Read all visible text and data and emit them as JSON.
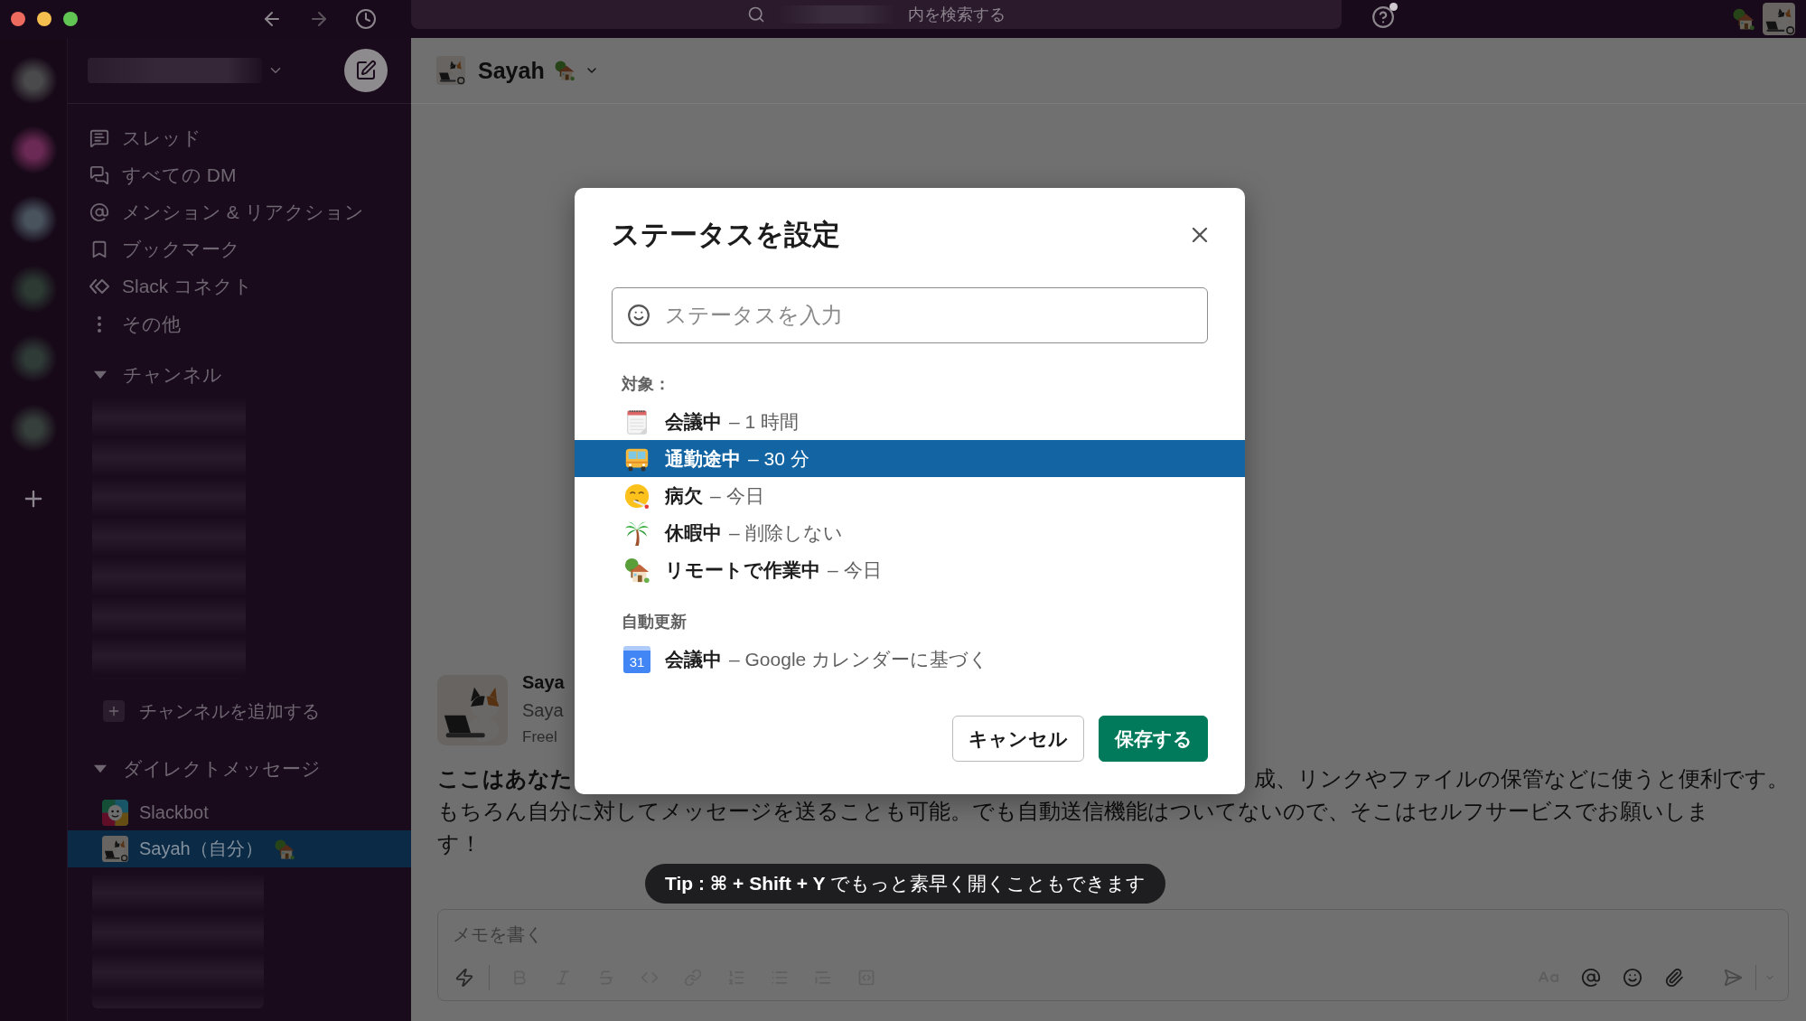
{
  "top_bar": {
    "search": {
      "placeholder": "内を検索する"
    }
  },
  "sidebar": {
    "nav_items": [
      {
        "label": "スレッド"
      },
      {
        "label": "すべての DM"
      },
      {
        "label": "メンション & リアクション"
      },
      {
        "label": "ブックマーク"
      },
      {
        "label": "Slack コネクト"
      },
      {
        "label": "その他"
      }
    ],
    "channels": {
      "title": "チャンネル",
      "expanded": true,
      "add_label": "チャンネルを追加する"
    },
    "direct_messages": {
      "title": "ダイレクトメッセージ",
      "expanded": true,
      "items": [
        {
          "name": "Slackbot",
          "kind": "bot",
          "selected": false
        },
        {
          "name": "Sayah（自分）",
          "kind": "self",
          "selected": true
        }
      ]
    }
  },
  "channel_header": {
    "title": "Sayah"
  },
  "message": {
    "profile_lines": [
      "Saya",
      "Saya",
      "Freel"
    ],
    "line_1_start": "ここはあなた",
    "line_1_end": "成、リンクやファイルの保管などに使うと便利です。",
    "continuation": "もちろん自分に対してメッセージを送ることも可能。でも自動送信機能はついてないので、そこはセルフサービスでお願いします！"
  },
  "composer": {
    "placeholder": "メモを書く"
  },
  "tooltip": {
    "text": "**Tip : ⌘ + Shift + Y** でもっと素早く開くこともできます"
  },
  "dialog": {
    "title": "ステータスを設定",
    "input": {
      "placeholder": "ステータスを入力"
    },
    "presets_label": "対象：",
    "presets": [
      {
        "title": "会議中",
        "detail": "– 1 時間",
        "selected": false
      },
      {
        "title": "通勤途中",
        "detail": "– 30 分",
        "selected": true
      },
      {
        "title": "病欠",
        "detail": "– 今日",
        "selected": false
      },
      {
        "title": "休暇中",
        "detail": "– 削除しない",
        "selected": false
      },
      {
        "title": "リモートで作業中",
        "detail": "– 今日",
        "selected": false
      }
    ],
    "auto_label": "自動更新",
    "auto_items": [
      {
        "title": "会議中",
        "detail": "– Google カレンダーに基づく",
        "date": "31",
        "selected": false
      }
    ],
    "buttons": [
      {
        "label": "キャンセル",
        "kind": "secondary"
      },
      {
        "label": "保存する",
        "kind": "primary"
      }
    ]
  }
}
